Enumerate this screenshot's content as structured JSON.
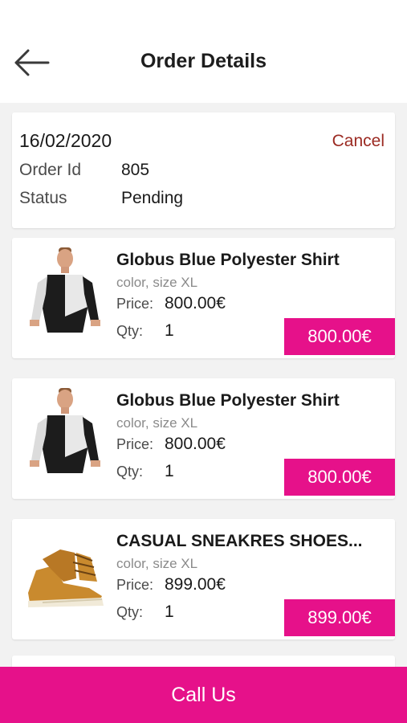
{
  "header": {
    "title": "Order Details",
    "back_icon": "arrow-left-icon"
  },
  "order": {
    "date": "16/02/2020",
    "cancel_label": "Cancel",
    "order_id_label": "Order Id",
    "order_id": "805",
    "status_label": "Status",
    "status": "Pending"
  },
  "items": [
    {
      "name": "Globus Blue Polyester Shirt",
      "variant": "color, size XL",
      "price_label": "Price:",
      "price": "800.00€",
      "qty_label": "Qty:",
      "qty": "1",
      "total": "800.00€",
      "image": "shirt-model-image"
    },
    {
      "name": "Globus Blue Polyester Shirt",
      "variant": "color, size XL",
      "price_label": "Price:",
      "price": "800.00€",
      "qty_label": "Qty:",
      "qty": "1",
      "total": "800.00€",
      "image": "shirt-model-image"
    },
    {
      "name": "CASUAL SNEAKRES SHOES...",
      "variant": "color, size XL",
      "price_label": "Price:",
      "price": "899.00€",
      "qty_label": "Qty:",
      "qty": "1",
      "total": "899.00€",
      "image": "sneaker-shoe-image"
    }
  ],
  "footer": {
    "call_label": "Call Us"
  },
  "colors": {
    "accent": "#e6118a",
    "cancel": "#9b2a22",
    "background": "#f2f2f2"
  }
}
